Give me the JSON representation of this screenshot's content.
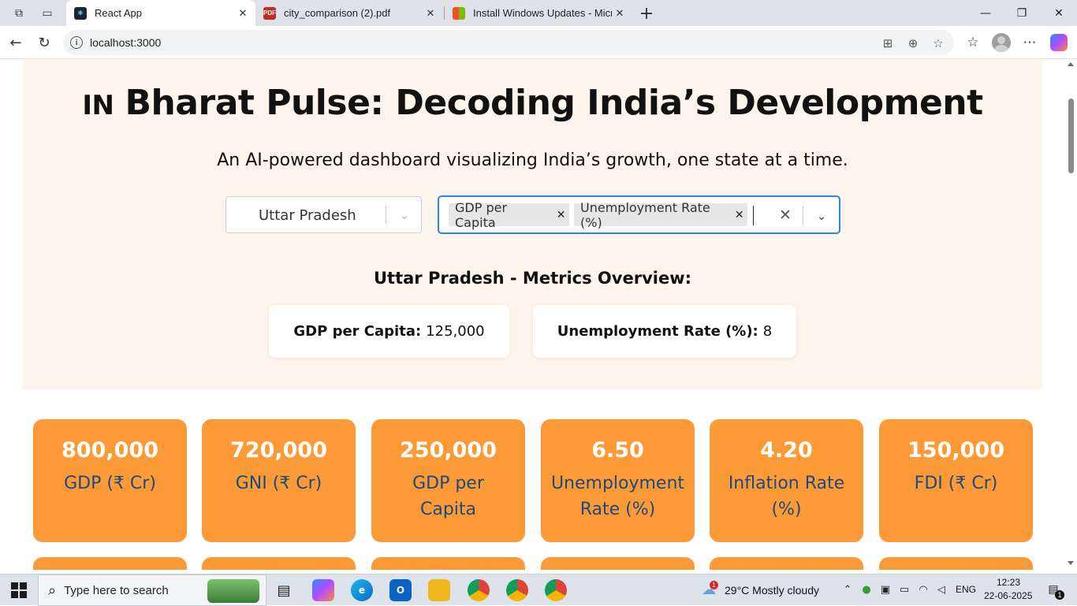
{
  "browser": {
    "tabs": [
      {
        "title": "React App",
        "active": true
      },
      {
        "title": "city_comparison (2).pdf",
        "active": false
      },
      {
        "title": "Install Windows Updates - Micros",
        "active": false
      }
    ],
    "url": "localhost:3000"
  },
  "hero": {
    "flag": "IN",
    "title": "Bharat Pulse: Decoding India’s Development",
    "subtitle": "An AI-powered dashboard visualizing India’s growth, one state at a time."
  },
  "state_select": {
    "value": "Uttar Pradesh"
  },
  "metric_select": {
    "chips": [
      "GDP per Capita",
      "Unemployment Rate (%)"
    ]
  },
  "overview": {
    "title": "Uttar Pradesh - Metrics Overview:",
    "items": [
      {
        "label": "GDP per Capita:",
        "value": "125,000"
      },
      {
        "label": "Unemployment Rate (%):",
        "value": "8"
      }
    ]
  },
  "stats": [
    {
      "value": "800,000",
      "label": "GDP (₹ Cr)"
    },
    {
      "value": "720,000",
      "label": "GNI (₹ Cr)"
    },
    {
      "value": "250,000",
      "label": "GDP per Capita"
    },
    {
      "value": "6.50",
      "label": "Unemployment Rate (%)"
    },
    {
      "value": "4.20",
      "label": "Inflation Rate (%)"
    },
    {
      "value": "150,000",
      "label": "FDI (₹ Cr)"
    }
  ],
  "taskbar": {
    "search_placeholder": "Type here to search",
    "weather_badge": "1",
    "weather": "29°C  Mostly cloudy",
    "language": "ENG",
    "time": "12:23",
    "date": "22-06-2025",
    "notification_count": "1"
  },
  "colors": {
    "hero_bg": "#fdf5ec",
    "stat_card": "#fd9a38",
    "stat_label": "#1e4a7a",
    "select_focus": "#2684ff"
  }
}
